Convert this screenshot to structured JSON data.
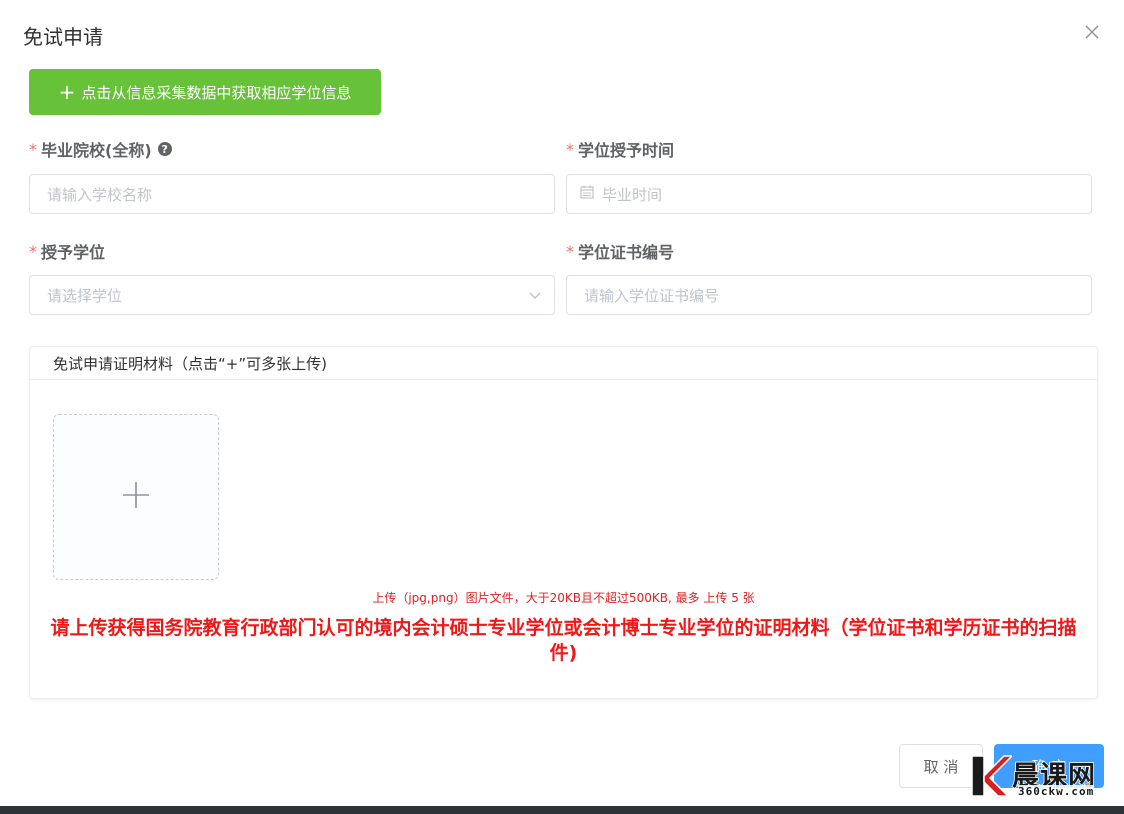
{
  "dialog": {
    "title": "免试申请",
    "fetch_button": "点击从信息采集数据中获取相应学位信息",
    "fields": {
      "school": {
        "label": "毕业院校(全称)",
        "placeholder": "请输入学校名称"
      },
      "award_time": {
        "label": "学位授予时间",
        "placeholder": "毕业时间"
      },
      "degree": {
        "label": "授予学位",
        "placeholder": "请选择学位"
      },
      "certificate_no": {
        "label": "学位证书编号",
        "placeholder": "请输入学位证书编号"
      }
    },
    "required_mark": "*",
    "help_icon_glyph": "?",
    "upload": {
      "header": "免试申请证明材料（点击“+”可多张上传)",
      "hint": "上传（jpg,png）图片文件，大于20KB且不超过500KB, 最多 上传 5 张",
      "notice": "请上传获得国务院教育行政部门认可的境内会计硕士专业学位或会计博士专业学位的证明材料（学位证书和学历证书的扫描件)"
    },
    "buttons": {
      "cancel": "取 消",
      "confirm": "确 定"
    }
  },
  "watermark": {
    "brand": "晨课网",
    "url": "360ckw.com"
  },
  "colors": {
    "fetch_button": "#67c23a",
    "primary": "#409eff",
    "required": "#f56c6c",
    "notice_red": "#f21717"
  }
}
